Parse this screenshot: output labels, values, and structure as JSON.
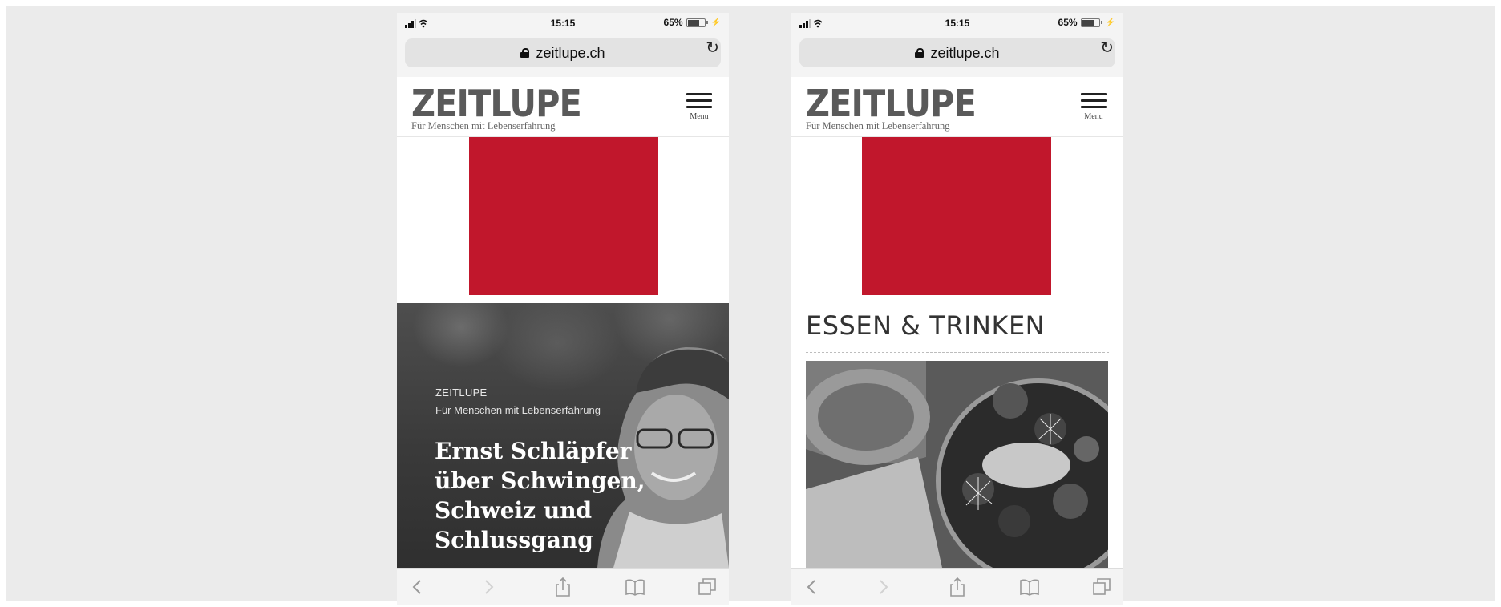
{
  "screens": [
    {
      "status": {
        "time": "15:15",
        "battery": "65%",
        "battery_level": 0.65
      },
      "url": "zeitlupe.ch",
      "site": {
        "logo": "ZEITLUPE",
        "tagline": "Für Menschen mit Lebenserfahrung",
        "menu_label": "Menu"
      },
      "hero": {
        "brand": "ZEITLUPE",
        "subtitle": "Für Menschen mit Lebenserfahrung",
        "title_lines": [
          "Ernst Schläpfer",
          "über Schwingen,",
          "Schweiz und",
          "Schlussgang"
        ]
      }
    },
    {
      "status": {
        "time": "15:15",
        "battery": "65%",
        "battery_level": 0.65
      },
      "url": "zeitlupe.ch",
      "site": {
        "logo": "ZEITLUPE",
        "tagline": "Für Menschen mit Lebenserfahrung",
        "menu_label": "Menu"
      },
      "section": {
        "title": "ESSEN & TRINKEN"
      }
    }
  ],
  "colors": {
    "ad": "#c1172c",
    "page_bg": "#ebebeb"
  },
  "icons": [
    "signal-icon",
    "wifi-icon",
    "battery-icon",
    "lock-icon",
    "reload-icon",
    "hamburger-menu-icon",
    "back-icon",
    "forward-icon",
    "share-icon",
    "bookmarks-icon",
    "tabs-icon"
  ]
}
